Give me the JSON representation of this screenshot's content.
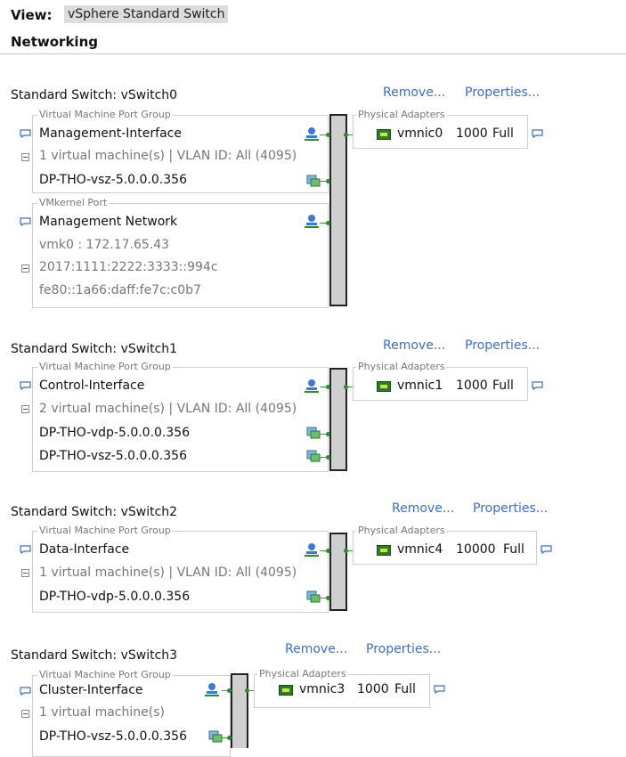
{
  "header": {
    "view_label": "View:",
    "view_value": "vSphere Standard Switch",
    "section_title": "Networking"
  },
  "switches": [
    {
      "title": "Standard Switch: vSwitch0",
      "remove_label": "Remove...",
      "properties_label": "Properties...",
      "port_groups": [
        {
          "legend": "Virtual Machine Port Group",
          "name": "Management-Interface",
          "summary": "1 virtual machine(s) | VLAN ID: All (4095)",
          "vms": [
            "DP-THO-vsz-5.0.0.0.356"
          ]
        },
        {
          "legend": "VMkernel Port",
          "name": "Management Network",
          "ip4": "vmk0 : 172.17.65.43",
          "ipv6": [
            "2017:1111:2222:3333::994c",
            "fe80::1a66:daff:fe7c:c0b7"
          ]
        }
      ],
      "adapters": {
        "legend": "Physical Adapters",
        "name": "vmnic0",
        "speed": "1000",
        "duplex": "Full"
      }
    },
    {
      "title": "Standard Switch: vSwitch1",
      "remove_label": "Remove...",
      "properties_label": "Properties...",
      "port_groups": [
        {
          "legend": "Virtual Machine Port Group",
          "name": "Control-Interface",
          "summary": "2 virtual machine(s) | VLAN ID: All (4095)",
          "vms": [
            "DP-THO-vdp-5.0.0.0.356",
            "DP-THO-vsz-5.0.0.0.356"
          ]
        }
      ],
      "adapters": {
        "legend": "Physical Adapters",
        "name": "vmnic1",
        "speed": "1000",
        "duplex": "Full"
      }
    },
    {
      "title": "Standard Switch: vSwitch2",
      "remove_label": "Remove...",
      "properties_label": "Properties...",
      "port_groups": [
        {
          "legend": "Virtual Machine Port Group",
          "name": "Data-Interface",
          "summary": "1 virtual machine(s) | VLAN ID: All (4095)",
          "vms": [
            "DP-THO-vdp-5.0.0.0.356"
          ]
        }
      ],
      "adapters": {
        "legend": "Physical Adapters",
        "name": "vmnic4",
        "speed": "10000",
        "duplex": "Full"
      }
    },
    {
      "title": "Standard Switch: vSwitch3",
      "remove_label": "Remove...",
      "properties_label": "Properties...",
      "port_groups": [
        {
          "legend": "Virtual Machine Port Group",
          "name": "Cluster-Interface",
          "summary": "1 virtual machine(s)",
          "vms": [
            "DP-THO-vsz-5.0.0.0.356"
          ]
        }
      ],
      "adapters": {
        "legend": "Physical Adapters",
        "name": "vmnic3",
        "speed": "1000",
        "duplex": "Full"
      }
    }
  ],
  "colors": {
    "link": "#3a6ec8",
    "wire": "#3a9a3a",
    "nic": "#2e7a2a"
  },
  "icons": {
    "info": "speech-bubble-icon",
    "port_group": "network-person-icon",
    "vm": "virtual-machine-icon",
    "nic": "network-card-icon",
    "collapse": "collapse-icon"
  }
}
